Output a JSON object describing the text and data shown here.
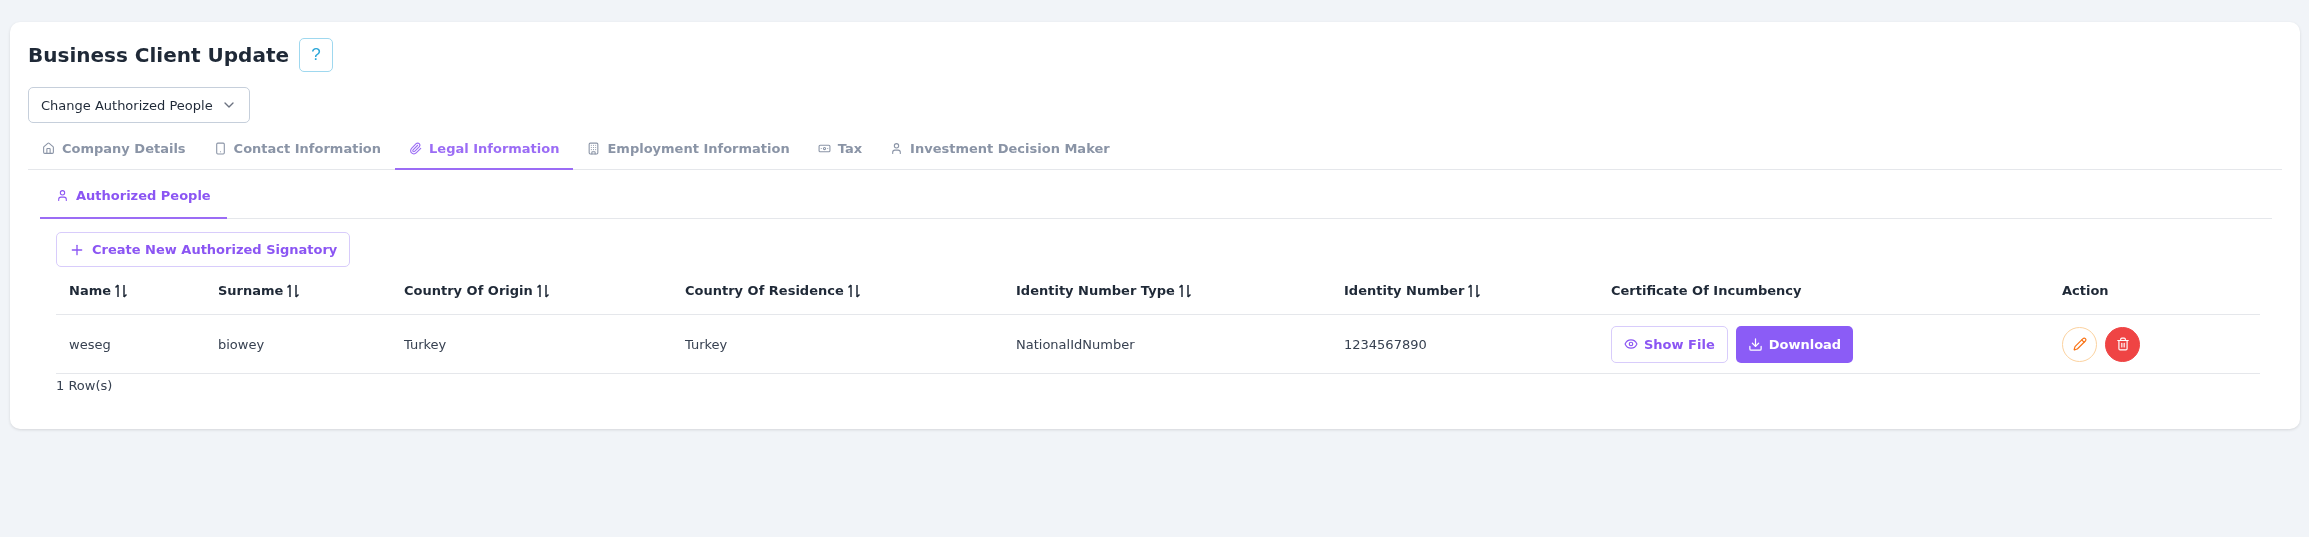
{
  "title": "Business Client Update",
  "help_button": "?",
  "mode_select": {
    "value": "Change Authorized People"
  },
  "tabs": [
    {
      "label": "Company Details",
      "kind": "house",
      "selected": false
    },
    {
      "label": "Contact Information",
      "kind": "phone",
      "selected": false
    },
    {
      "label": "Legal Information",
      "kind": "paperclip",
      "selected": true
    },
    {
      "label": "Employment Information",
      "kind": "building",
      "selected": false
    },
    {
      "label": "Tax",
      "kind": "banknote",
      "selected": false
    },
    {
      "label": "Investment Decision Maker",
      "kind": "user",
      "selected": false
    }
  ],
  "subtabs": [
    {
      "label": "Authorized People",
      "selected": true
    }
  ],
  "create_button": "Create New Authorized Signatory",
  "table": {
    "columns": [
      {
        "label": "Name",
        "sortable": true
      },
      {
        "label": "Surname",
        "sortable": true
      },
      {
        "label": "Country Of Origin",
        "sortable": true
      },
      {
        "label": "Country Of Residence",
        "sortable": true
      },
      {
        "label": "Identity Number Type",
        "sortable": true
      },
      {
        "label": "Identity Number",
        "sortable": true
      },
      {
        "label": "Certificate Of Incumbency",
        "sortable": false
      },
      {
        "label": "Action",
        "sortable": false
      }
    ],
    "rows": [
      {
        "cells": [
          "weseg",
          "biowey",
          "Turkey",
          "Turkey",
          "NationalIdNumber",
          "1234567890"
        ],
        "show_file": "Show File",
        "download": "Download"
      }
    ]
  },
  "row_count": "1 Row(s)"
}
